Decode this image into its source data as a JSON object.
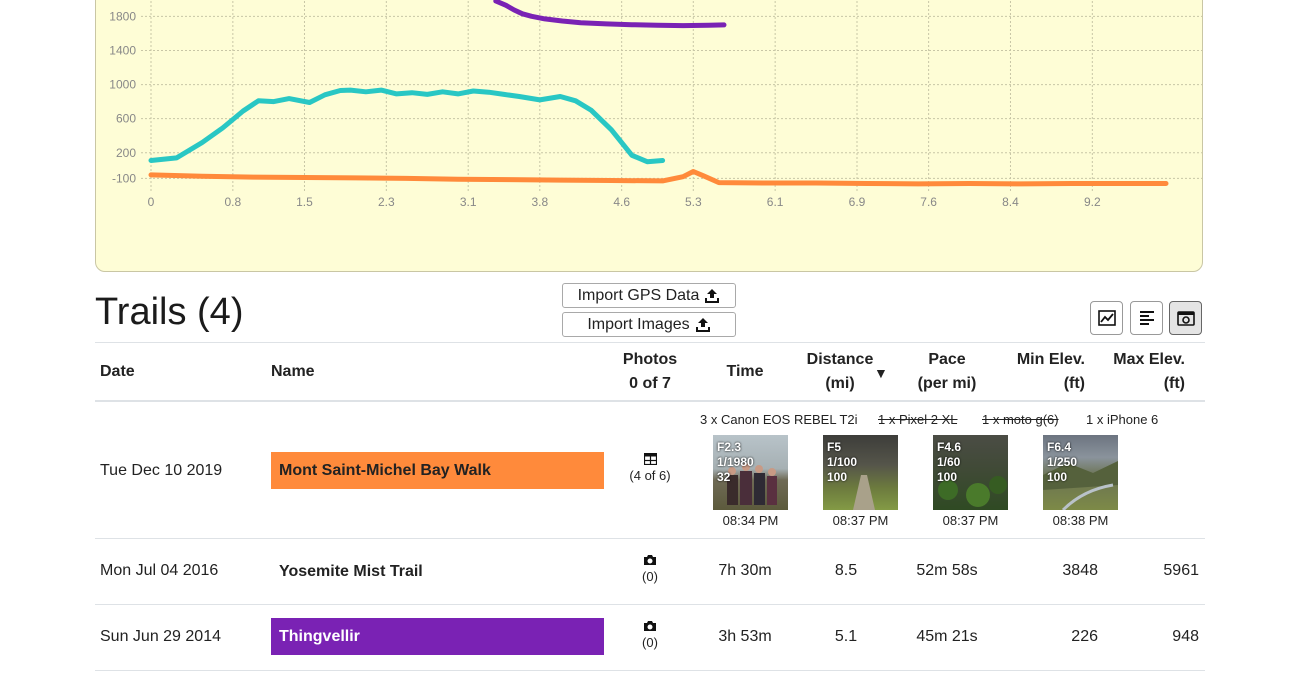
{
  "chart_data": {
    "type": "line",
    "x_ticks": [
      "0",
      "0.8",
      "1.5",
      "2.3",
      "3.1",
      "3.8",
      "4.6",
      "5.3",
      "6.1",
      "6.9",
      "7.6",
      "8.4",
      "9.2"
    ],
    "y_ticks": [
      "-100",
      "200",
      "600",
      "1000",
      "1400",
      "1800"
    ],
    "x_range": [
      0,
      9.92
    ],
    "y_range": [
      -260,
      1980
    ],
    "grid": true,
    "series": [
      {
        "color": "#7a22b4",
        "x": [
          3.37,
          3.47,
          3.55,
          3.63,
          3.72,
          3.85,
          4.02,
          4.2,
          4.45,
          4.7,
          4.95,
          5.2,
          5.45,
          5.6
        ],
        "y": [
          1980,
          1930,
          1875,
          1830,
          1800,
          1770,
          1745,
          1725,
          1712,
          1702,
          1695,
          1692,
          1695,
          1700
        ]
      },
      {
        "color": "#29c7c4",
        "x": [
          0.0,
          0.25,
          0.5,
          0.7,
          0.9,
          1.05,
          1.2,
          1.35,
          1.55,
          1.7,
          1.85,
          1.95,
          2.1,
          2.25,
          2.4,
          2.55,
          2.7,
          2.85,
          3.0,
          3.15,
          3.3,
          3.45,
          3.6,
          3.8,
          4.0,
          4.15,
          4.3,
          4.5,
          4.7,
          4.85,
          5.0
        ],
        "y": [
          110,
          140,
          320,
          490,
          690,
          810,
          800,
          835,
          790,
          880,
          930,
          935,
          915,
          935,
          890,
          905,
          885,
          915,
          890,
          925,
          910,
          885,
          860,
          820,
          860,
          810,
          700,
          470,
          170,
          95,
          110
        ]
      },
      {
        "color": "#ff8a3b",
        "x": [
          0.0,
          0.5,
          1.0,
          1.5,
          2.0,
          2.5,
          3.0,
          3.5,
          4.0,
          4.5,
          5.0,
          5.2,
          5.3,
          5.4,
          5.55,
          6.0,
          6.5,
          7.0,
          7.5,
          8.0,
          8.5,
          9.0,
          9.5,
          9.92
        ],
        "y": [
          -60,
          -75,
          -85,
          -90,
          -95,
          -100,
          -110,
          -115,
          -120,
          -125,
          -130,
          -80,
          -20,
          -70,
          -150,
          -155,
          -155,
          -160,
          -165,
          -160,
          -165,
          -160,
          -160,
          -160
        ]
      }
    ]
  },
  "toolbar": {
    "title": "Trails (4)",
    "import_gps": "Import GPS Data",
    "import_images": "Import Images"
  },
  "table": {
    "headers": {
      "date": "Date",
      "name": "Name",
      "photos_line1": "Photos",
      "photos_line2": "0 of 7",
      "time": "Time",
      "distance_line1": "Distance",
      "distance_line2": "(mi)",
      "sort_indicator": "▼",
      "pace_line1": "Pace",
      "pace_line2": "(per mi)",
      "min_elev_line1": "Min Elev.",
      "min_elev_line2": "(ft)",
      "max_elev_line1": "Max Elev.",
      "max_elev_line2": "(ft)"
    },
    "rows": [
      {
        "date": "Tue Dec 10 2019",
        "name": "Mont Saint-Michel Bay Walk",
        "color": "#ff8a3b",
        "photos": "(4 of 6)",
        "cameras": [
          {
            "label": "3 x Canon EOS REBEL T2i",
            "excluded": false
          },
          {
            "label": "1 x Pixel 2 XL",
            "excluded": true
          },
          {
            "label": "1 x moto g(6)",
            "excluded": true
          },
          {
            "label": "1 x iPhone 6",
            "excluded": false
          }
        ],
        "thumbs": [
          {
            "aperture": "F2.3",
            "shutter": "1/1980",
            "iso": "32",
            "time": "08:34 PM"
          },
          {
            "aperture": "F5",
            "shutter": "1/100",
            "iso": "100",
            "time": "08:37 PM"
          },
          {
            "aperture": "F4.6",
            "shutter": "1/60",
            "iso": "100",
            "time": "08:37 PM"
          },
          {
            "aperture": "F6.4",
            "shutter": "1/250",
            "iso": "100",
            "time": "08:38 PM"
          }
        ]
      },
      {
        "date": "Mon Jul 04 2016",
        "name": "Yosemite Mist Trail",
        "photos": "(0)",
        "time": "7h 30m",
        "distance": "8.5",
        "pace": "52m 58s",
        "min_elev": "3848",
        "max_elev": "5961"
      },
      {
        "date": "Sun Jun 29 2014",
        "name": "Thingvellir",
        "color": "#7a22b4",
        "photos": "(0)",
        "time": "3h 53m",
        "distance": "5.1",
        "pace": "45m 21s",
        "min_elev": "226",
        "max_elev": "948"
      }
    ]
  }
}
